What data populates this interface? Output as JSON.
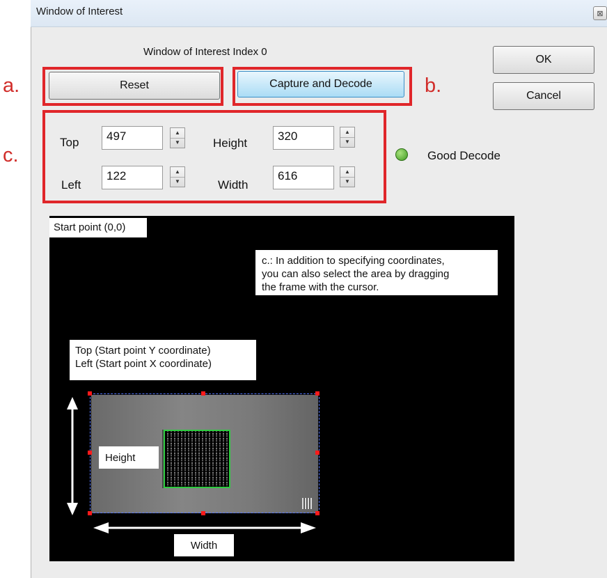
{
  "window": {
    "title": "Window of Interest",
    "close_glyph": "⊠"
  },
  "header": {
    "index_label": "Window of Interest  Index 0"
  },
  "buttons": {
    "reset": "Reset",
    "capture": "Capture and Decode",
    "ok": "OK",
    "cancel": "Cancel"
  },
  "annotations": {
    "a": "a.",
    "b": "b.",
    "c": "c."
  },
  "fields": {
    "top": {
      "label": "Top",
      "value": "497"
    },
    "height": {
      "label": "Height",
      "value": "320"
    },
    "left": {
      "label": "Left",
      "value": "122"
    },
    "width": {
      "label": "Width",
      "value": "616"
    }
  },
  "status": {
    "text": "Good Decode",
    "led_color": "#3f9a22"
  },
  "preview": {
    "start_point": "Start point (0,0)",
    "note_lines": [
      "c.: In addition to specifying coordinates,",
      "you can also select the area by dragging",
      "the frame with the cursor."
    ],
    "topleft_lines": [
      "Top (Start point Y coordinate)",
      "Left (Start point X coordinate)"
    ],
    "height_label": "Height",
    "width_label": "Width"
  },
  "colors": {
    "highlight_red": "#e0262a",
    "annotation_red": "#d12d2a",
    "decode_frame_green": "#2ecc40",
    "roi_handle_red": "#ff1a1a"
  }
}
